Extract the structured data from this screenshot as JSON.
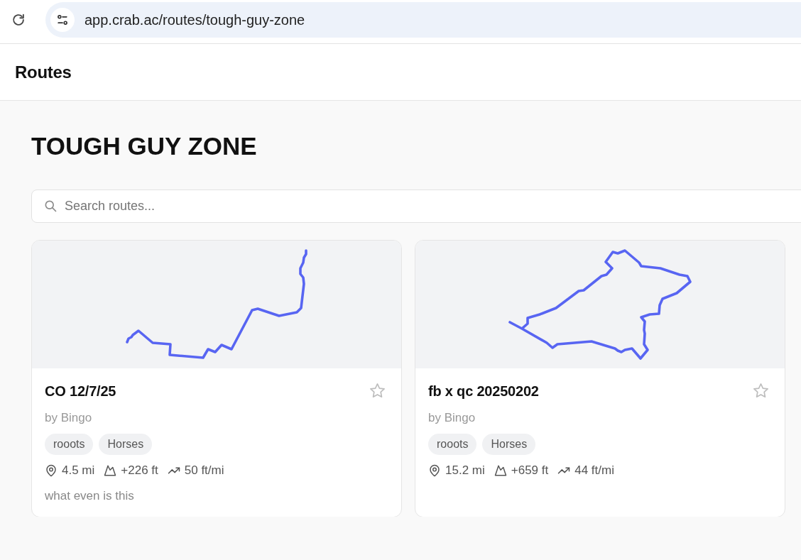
{
  "browser": {
    "url": "app.crab.ac/routes/tough-guy-zone"
  },
  "header": {
    "title": "Routes"
  },
  "page": {
    "title": "TOUGH GUY ZONE",
    "search": {
      "placeholder": "Search routes..."
    }
  },
  "routes": [
    {
      "title": "CO 12/7/25",
      "author": "by Bingo",
      "starred": false,
      "tags": [
        "rooots",
        "Horses"
      ],
      "stats": [
        {
          "kind": "distance",
          "value": "4.5 mi"
        },
        {
          "kind": "elevation",
          "value": "+226 ft"
        },
        {
          "kind": "grade",
          "value": "50 ft/mi"
        }
      ],
      "description": "what even is this"
    },
    {
      "title": "fb x qc 20250202",
      "author": "by Bingo",
      "starred": false,
      "tags": [
        "rooots",
        "Horses"
      ],
      "stats": [
        {
          "kind": "distance",
          "value": "15.2 mi"
        },
        {
          "kind": "elevation",
          "value": "+659 ft"
        },
        {
          "kind": "grade",
          "value": "44 ft/mi"
        }
      ]
    }
  ]
}
